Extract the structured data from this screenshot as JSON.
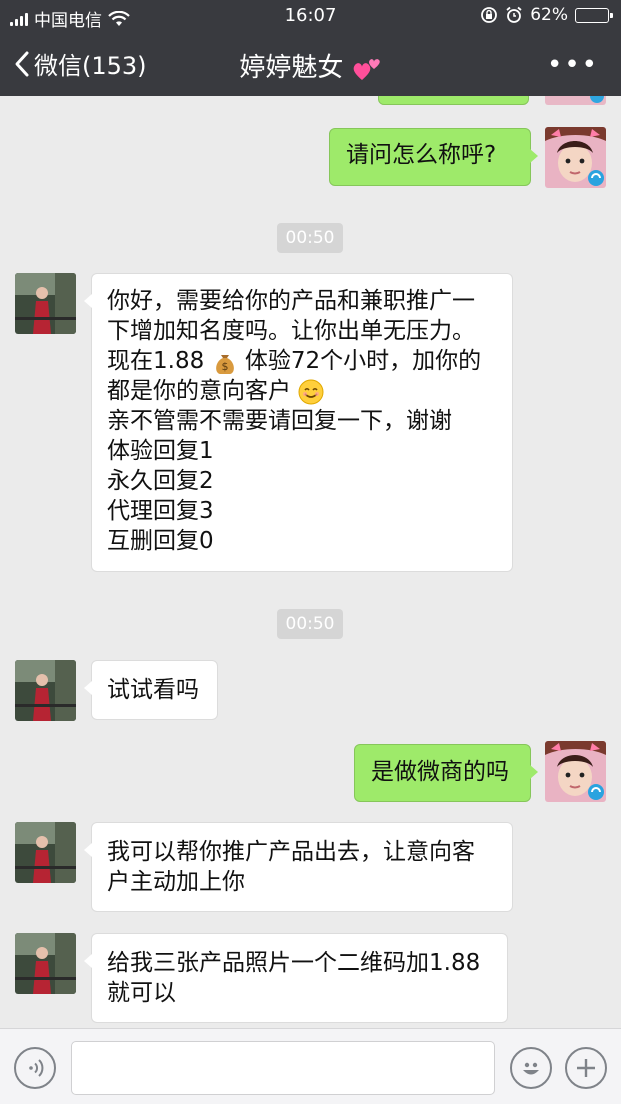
{
  "status_bar": {
    "carrier": "中国电信",
    "time": "16:07",
    "battery": "62%",
    "battery_level": 0.62
  },
  "nav": {
    "back_label": "微信(153)",
    "title": "婷婷魅女"
  },
  "messages": [
    {
      "side": "right",
      "text": "请问怎么称呼?"
    },
    {
      "type": "timestamp",
      "text": "00:50"
    },
    {
      "side": "left",
      "lines": [
        "你好，需要给你的产品和兼职推广一",
        "下增加知名度吗。让你出单无压力。",
        "现在1.88",
        "体验72个小时，加你的",
        "都是你的意向客户",
        "亲不管需不需要请回复一下，谢谢",
        "体验回复1",
        "永久回复2",
        "代理回复3",
        "互删回复0"
      ]
    },
    {
      "type": "timestamp",
      "text": "00:50"
    },
    {
      "side": "left",
      "text": "试试看吗"
    },
    {
      "side": "right",
      "text": "是做微商的吗"
    },
    {
      "side": "left",
      "lines": [
        "我可以帮你推广产品出去，让意向客",
        "户主动加上你"
      ]
    },
    {
      "side": "left",
      "lines": [
        "给我三张产品照片一个二维码加1.88",
        "就可以"
      ]
    }
  ],
  "colors": {
    "header_bg": "#393a3f",
    "chat_bg": "#ebebeb",
    "bubble_out": "#9eea6a",
    "bubble_in": "#ffffff"
  }
}
